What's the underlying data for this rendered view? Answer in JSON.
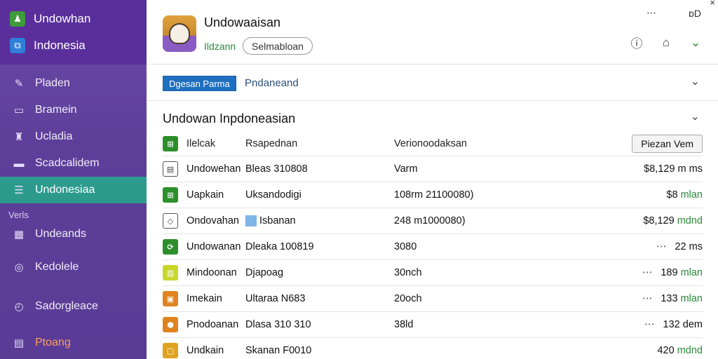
{
  "sidebar": {
    "brand": [
      {
        "label": "Undowhan",
        "icon": "app-logo-icon",
        "color": "#3e9b3a"
      },
      {
        "label": "Indonesia",
        "icon": "folder-icon",
        "color": "#2f7fd8"
      }
    ],
    "items": [
      {
        "label": "Pladen",
        "icon": "pencil-icon"
      },
      {
        "label": "Bramein",
        "icon": "monitor-icon"
      },
      {
        "label": "Ucladia",
        "icon": "shirt-icon"
      },
      {
        "label": "Scadcalidem",
        "icon": "inbox-icon"
      },
      {
        "label": "Undonesiaa",
        "icon": "list-icon",
        "active": true
      }
    ],
    "section_label": "Verls",
    "items2": [
      {
        "label": "Undeands",
        "icon": "grid-icon"
      },
      {
        "label": "Kedolele",
        "icon": "gauge-icon"
      },
      {
        "label": "Sadorgleace",
        "icon": "clock-icon"
      },
      {
        "label": "Ptoang",
        "icon": "calendar-icon"
      }
    ]
  },
  "header": {
    "title": "Undowaaisan",
    "subtitle": "Ildzann",
    "pill": "Selmabloan",
    "top_icons": [
      "⋯",
      "⋯",
      "ɒD"
    ],
    "close": "×"
  },
  "filter": {
    "button": "Dgesan Parma",
    "label": "Pndaneand"
  },
  "section": {
    "title": "Undowan Inpdoneasian"
  },
  "table": {
    "header": {
      "c1": "Ilelcak",
      "c2": "Rsapednan",
      "c3": "Verionoodaksan",
      "button": "Piezan Vem"
    },
    "rows": [
      {
        "name": "Undowehan",
        "c2": "Bleas 310808",
        "c3": "Varm",
        "value": "$8,129 m",
        "unit": "ms",
        "icon_color": "#ffffff",
        "icon_border": "#555",
        "icon_text": "▤",
        "green": false
      },
      {
        "name": "Uapkain",
        "c2": "Uksandodigi",
        "c3": "108rm 21100080)",
        "value": "$8",
        "unit": "mlan",
        "icon_color": "#2d8f2b",
        "icon_text": "⊞",
        "green": true
      },
      {
        "name": "Ondovahan",
        "c2": "Isbanan",
        "c3": "248 m1000080)",
        "value": "$8,129",
        "unit": "mdnd",
        "icon_color": "#ffffff",
        "icon_border": "#555",
        "icon_text": "◇",
        "green": true,
        "chip": true
      },
      {
        "name": "Undowanan",
        "c2": "Dleaka 100819",
        "c3": "3080",
        "value": "22",
        "unit": "ms",
        "icon_color": "#2d8f2b",
        "icon_text": "⟳",
        "green": false,
        "dots": true
      },
      {
        "name": "Mindoonan",
        "c2": "Djapoag",
        "c3": "30nch",
        "value": "189",
        "unit": "mlan",
        "icon_color": "#c8d62a",
        "icon_text": "▥",
        "green": true,
        "dots": true
      },
      {
        "name": "Imekain",
        "c2": "Ultaraa N683",
        "c3": "20och",
        "value": "133",
        "unit": "mlan",
        "icon_color": "#e0831f",
        "icon_text": "▣",
        "green": true,
        "dots": true
      },
      {
        "name": "Pnodoanan",
        "c2": "Dlasa 310 310",
        "c3": "38ld",
        "value": "132",
        "unit": "dem",
        "icon_color": "#e0831f",
        "icon_text": "⬢",
        "green": false,
        "dots": true
      },
      {
        "name": "Undkain",
        "c2": "Skanan F0010",
        "c3": "",
        "value": "420",
        "unit": "mdnd",
        "icon_color": "#e0a21f",
        "icon_text": "▢",
        "green": true
      }
    ]
  }
}
